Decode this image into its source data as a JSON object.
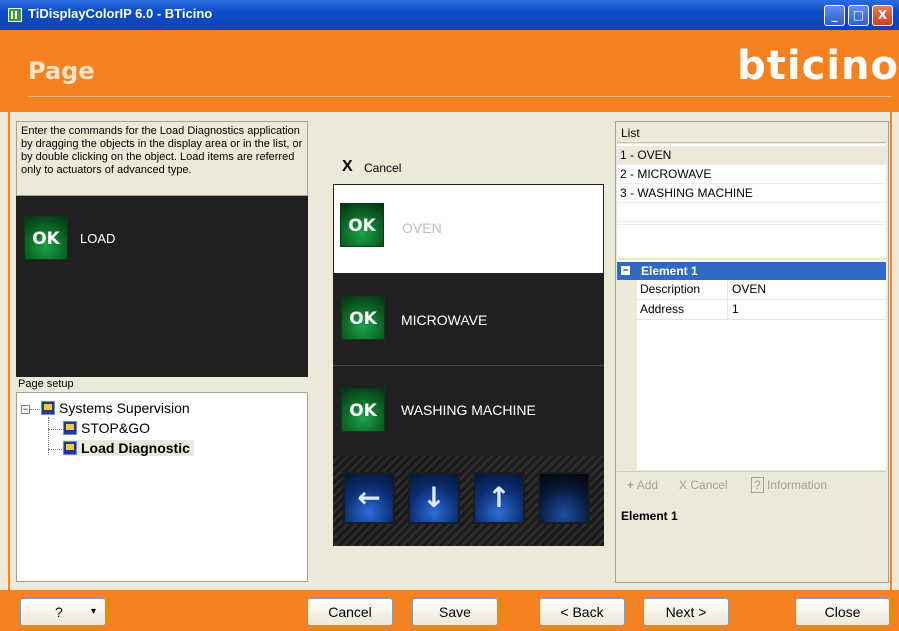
{
  "window": {
    "title": "TiDisplayColorIP 6.0 - BTicino",
    "minimize": "_",
    "maximize": "□",
    "close": "X"
  },
  "header": {
    "page_title": "Page",
    "logo": "bticino"
  },
  "left": {
    "description": "Enter the commands for the Load Diagnostics application by dragging the objects in the display area or in the list, or by double clicking on the object. Load items are referred only to actuators of advanced type.",
    "preview_item": {
      "ok": "OK",
      "label": "LOAD"
    },
    "page_setup_label": "Page setup",
    "tree": [
      {
        "label": "Systems Supervision",
        "expander": "−"
      },
      {
        "label": "STOP&GO"
      },
      {
        "label": "Load Diagnostic"
      }
    ]
  },
  "center": {
    "cancel_label": "Cancel",
    "cancel_icon": "X",
    "items": [
      {
        "ok": "OK",
        "label": "OVEN"
      },
      {
        "ok": "OK",
        "label": "MICROWAVE"
      },
      {
        "ok": "OK",
        "label": "WASHING MACHINE"
      }
    ],
    "nav": [
      {
        "icon": "←"
      },
      {
        "icon": "↓"
      },
      {
        "icon": "↑"
      },
      {
        "icon": ""
      }
    ]
  },
  "right": {
    "list_header": "List",
    "list_items": [
      "1 - OVEN",
      "2 - MICROWAVE",
      "3 - WASHING MACHINE"
    ],
    "element_title": "Element 1",
    "expander": "−",
    "properties": [
      {
        "key": "Description",
        "value": "OVEN"
      },
      {
        "key": "Address",
        "value": "1"
      }
    ],
    "toolbar": {
      "add": "Add",
      "cancel": "Cancel",
      "information": "Information",
      "add_icon": "+",
      "cancel_icon": "X",
      "info_icon": "?"
    },
    "description_title": "Element 1"
  },
  "footer": {
    "help_label": "?",
    "help_arrow": "▾",
    "cancel": "Cancel",
    "save": "Save",
    "back": "< Back",
    "next": "Next >",
    "close": "Close"
  },
  "colors": {
    "accent_orange": "#f5821f",
    "title_blue": "#0a4cc9",
    "selection_blue": "#316ac5",
    "ok_green": "#1ea34a",
    "nav_blue": "#2d6ed8"
  }
}
